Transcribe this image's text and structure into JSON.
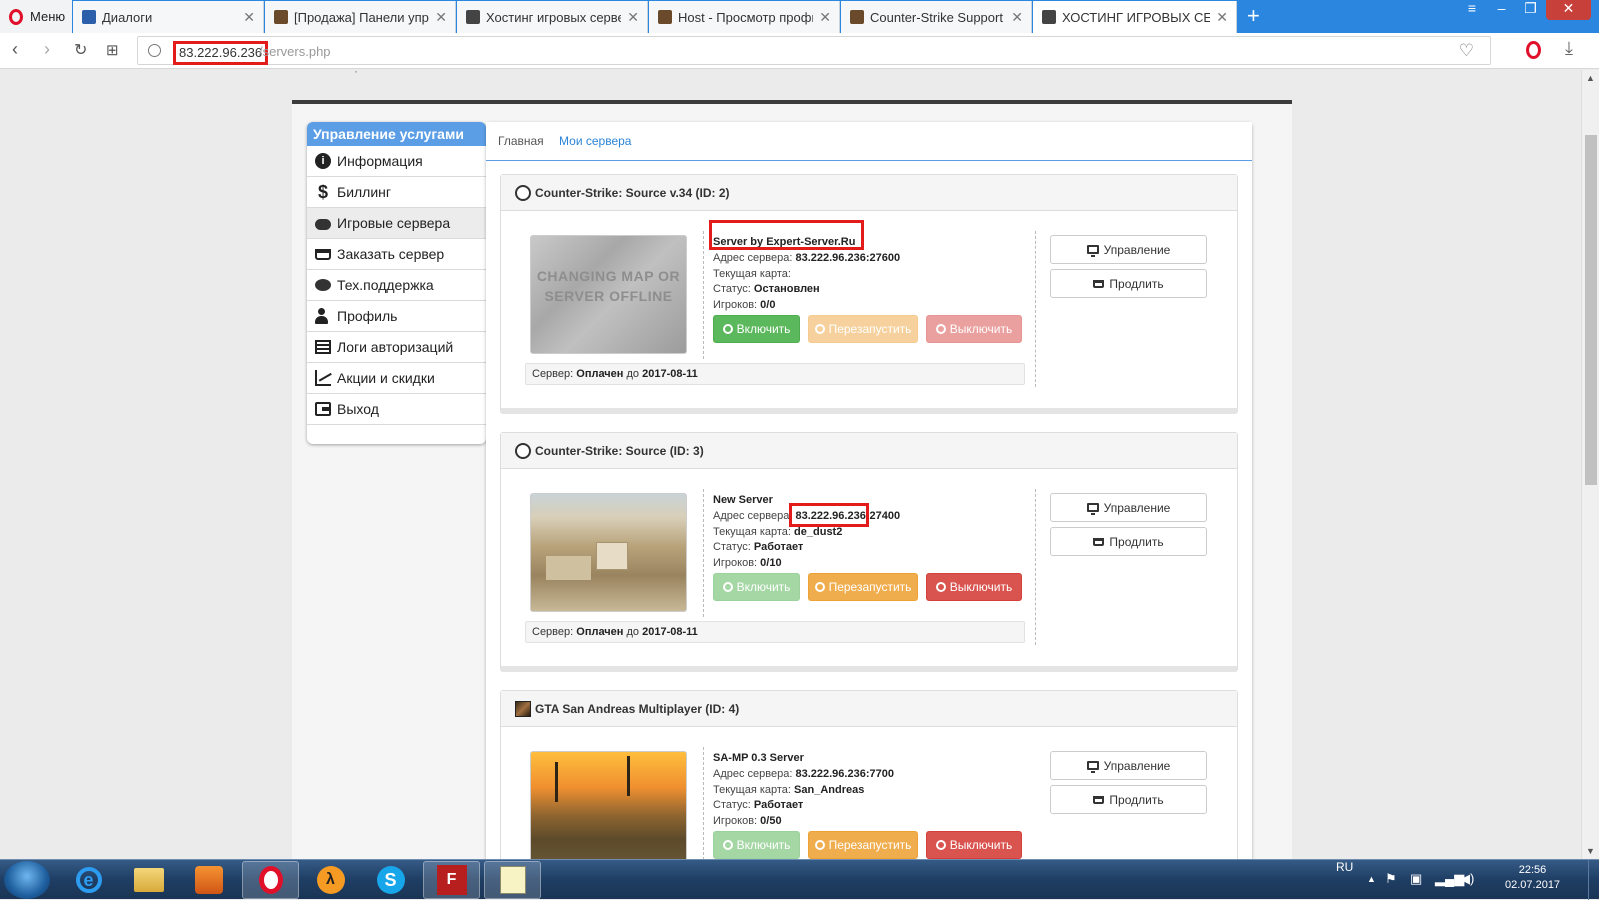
{
  "browser": {
    "menu_label": "Меню",
    "tabs": [
      {
        "title": "Диалоги",
        "icon": "chat-icon",
        "color": "#2b5faa"
      },
      {
        "title": "[Продажа] Панели управ",
        "icon": "counter-strike-icon",
        "color": "#6a4a2a"
      },
      {
        "title": "Хостинг игровых сервер",
        "icon": "counter-strike-icon",
        "color": "#444444"
      },
      {
        "title": "Host - Просмотр профил",
        "icon": "counter-strike-icon",
        "color": "#6a4a2a"
      },
      {
        "title": "Counter-Strike Support Co",
        "icon": "counter-strike-icon",
        "color": "#6a4a2a"
      },
      {
        "title": "ХОСТИНГ ИГРОВЫХ СЕРВЕ",
        "icon": "counter-strike-icon",
        "color": "#444444"
      }
    ],
    "url_host": "83.222.96.236",
    "url_path": "/servers.php"
  },
  "sidebar": {
    "header": "Управление услугами",
    "items": [
      {
        "label": "Информация",
        "icon": "info-icon"
      },
      {
        "label": "Биллинг",
        "icon": "dollar-icon"
      },
      {
        "label": "Игровые сервера",
        "icon": "gamepad-icon"
      },
      {
        "label": "Заказать сервер",
        "icon": "cart-icon"
      },
      {
        "label": "Тех.поддержка",
        "icon": "chat-icon"
      },
      {
        "label": "Профиль",
        "icon": "user-icon"
      },
      {
        "label": "Логи авторизаций",
        "icon": "list-icon"
      },
      {
        "label": "Акции и скидки",
        "icon": "chart-icon"
      },
      {
        "label": "Выход",
        "icon": "exit-icon"
      }
    ]
  },
  "breadcrumb": {
    "home": "Главная",
    "current": "Мои сервера"
  },
  "labels": {
    "address": "Адрес сервера:",
    "map": "Текущая карта:",
    "status": "Статус:",
    "players": "Игроков:",
    "server": "Сервер:",
    "paid": "Оплачен",
    "until": "до",
    "start": "Включить",
    "restart": "Перезапустить",
    "stop": "Выключить",
    "manage": "Управление",
    "renew": "Продлить",
    "offline_image_text": "CHANGING MAP OR SERVER OFFLINE"
  },
  "servers": [
    {
      "title": "Counter-Strike: Source v.34 (ID: 2)",
      "name": "Server by Expert-Server.Ru",
      "address": "83.222.96.236:27600",
      "map": "",
      "status": "Остановлен",
      "players": "0/0",
      "paid_until": "2017-08-11"
    },
    {
      "title": "Counter-Strike: Source (ID: 3)",
      "name": "New Server",
      "address": "83.222.96.236:27400",
      "map": "de_dust2",
      "status": "Работает",
      "players": "0/10",
      "paid_until": "2017-08-11"
    },
    {
      "title": "GTA San Andreas Multiplayer (ID: 4)",
      "name": "SA-MP 0.3 Server",
      "address": "83.222.96.236:7700",
      "map": "San_Andreas",
      "status": "Работает",
      "players": "0/50",
      "paid_until": ""
    }
  ],
  "taskbar": {
    "apps": [
      "ie-icon",
      "folder-icon",
      "media-player-icon",
      "opera-icon",
      "half-life-2-icon",
      "skype-icon",
      "filezilla-icon",
      "notepad-icon"
    ],
    "lang": "RU",
    "time": "22:56",
    "date": "02.07.2017"
  }
}
